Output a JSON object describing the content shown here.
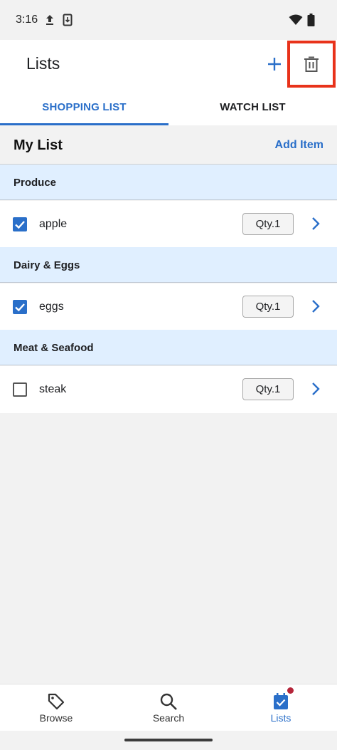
{
  "status_bar": {
    "time": "3:16"
  },
  "app_bar": {
    "title": "Lists"
  },
  "tabs": [
    {
      "label": "SHOPPING LIST",
      "active": true
    },
    {
      "label": "WATCH LIST",
      "active": false
    }
  ],
  "list": {
    "title": "My List",
    "add_item_label": "Add Item",
    "categories": [
      {
        "name": "Produce",
        "items": [
          {
            "name": "apple",
            "qty": "Qty.1",
            "checked": true
          }
        ]
      },
      {
        "name": "Dairy & Eggs",
        "items": [
          {
            "name": "eggs",
            "qty": "Qty.1",
            "checked": true
          }
        ]
      },
      {
        "name": "Meat & Seafood",
        "items": [
          {
            "name": "steak",
            "qty": "Qty.1",
            "checked": false
          }
        ]
      }
    ]
  },
  "bottom_nav": [
    {
      "label": "Browse",
      "icon": "tag-icon",
      "active": false
    },
    {
      "label": "Search",
      "icon": "search-icon",
      "active": false
    },
    {
      "label": "Lists",
      "icon": "calendar-check-icon",
      "active": true
    }
  ],
  "colors": {
    "accent": "#2a6fc9",
    "category_bg": "#e0efff",
    "highlight_border": "#e8321a",
    "badge": "#b5253a"
  }
}
